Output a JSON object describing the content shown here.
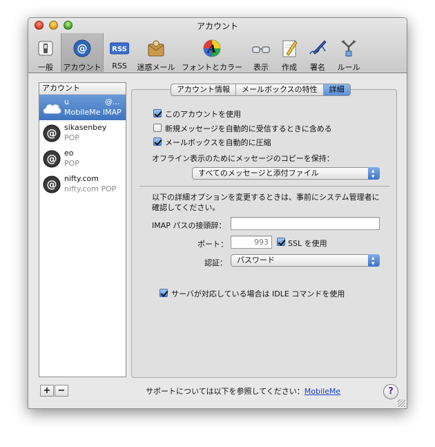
{
  "window": {
    "title": "アカウント"
  },
  "toolbar": {
    "items": [
      {
        "label": "一般",
        "icon": "switch-icon"
      },
      {
        "label": "アカウント",
        "icon": "at-icon"
      },
      {
        "label": "RSS",
        "icon": "rss-icon",
        "badge": "RSS"
      },
      {
        "label": "迷惑メール",
        "icon": "junk-mail-icon"
      },
      {
        "label": "フォントとカラー",
        "icon": "font-color-icon",
        "glyph": "A"
      },
      {
        "label": "表示",
        "icon": "glasses-icon"
      },
      {
        "label": "作成",
        "icon": "compose-icon"
      },
      {
        "label": "署名",
        "icon": "signature-icon"
      },
      {
        "label": "ルール",
        "icon": "rules-icon"
      }
    ],
    "selected": "アカウント"
  },
  "sidebar": {
    "header": "アカウント",
    "accounts": [
      {
        "name": "u",
        "extra": "@...",
        "type": "MobileMe IMAP",
        "icon": "cloud-icon"
      },
      {
        "name": "sikasenbey",
        "type": "POP",
        "icon": "at-icon"
      },
      {
        "name": "eo",
        "type": "POP",
        "icon": "at-icon"
      },
      {
        "name": "nifty.com",
        "type": "nifty.com POP",
        "icon": "at-icon"
      }
    ],
    "add_label": "+",
    "remove_label": "−"
  },
  "tabs": [
    {
      "label": "アカウント情報"
    },
    {
      "label": "メールボックスの特性"
    },
    {
      "label": "詳細",
      "active": true
    }
  ],
  "advanced": {
    "enable_account": {
      "label": "このアカウントを使用",
      "checked": true
    },
    "include_auto_check": {
      "label": "新規メッセージを自動的に受信するときに含める",
      "checked": false
    },
    "compact_mailboxes": {
      "label": "メールボックスを自動的に圧縮",
      "checked": true
    },
    "offline_label": "オフライン表示のためにメッセージのコピーを保持：",
    "offline_value": "すべてのメッセージと添付ファイル",
    "note": [
      "以下の詳細オプションを変更するときは、事前にシステム管理者に",
      "確認してください。"
    ],
    "imap_prefix_label": "IMAP パスの接頭辞：",
    "imap_prefix_value": "",
    "port_label": "ポート：",
    "port_value": "993",
    "ssl": {
      "label": "SSL を使用",
      "checked": true
    },
    "auth_label": "認証：",
    "auth_value": "パスワード",
    "idle": {
      "label": "サーバが対応している場合は IDLE コマンドを使用",
      "checked": true
    }
  },
  "footer": {
    "support_text": "サポートについては以下を参照してください：",
    "support_link": "MobileMe",
    "help_label": "?"
  }
}
